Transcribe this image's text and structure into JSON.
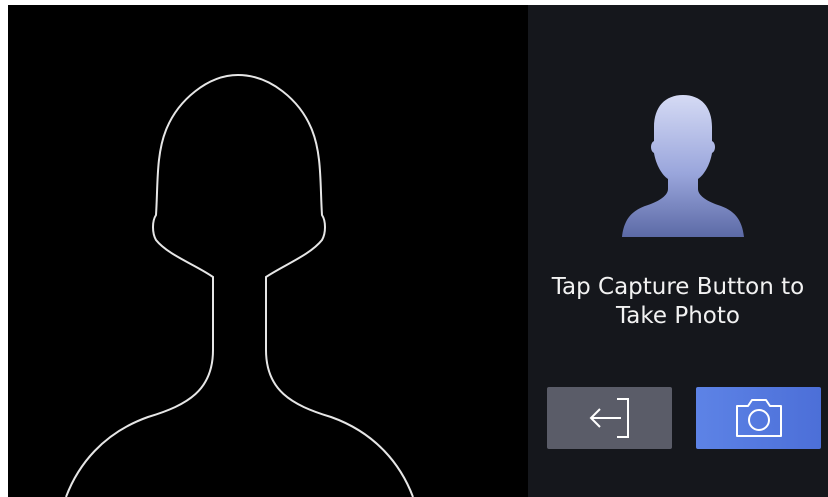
{
  "instruction": {
    "line1": "Tap Capture Button to",
    "line2": "Take Photo"
  },
  "buttons": {
    "back_icon": "back-arrow-icon",
    "capture_icon": "camera-icon"
  },
  "colors": {
    "screen_bg": "#000000",
    "panel_bg": "#15171c",
    "back_button": "#5a5c68",
    "capture_button": "#5d83e6",
    "outline": "#e6e6e6",
    "avatar_light": "#c9d0f0",
    "avatar_dark": "#5c6aa6"
  }
}
